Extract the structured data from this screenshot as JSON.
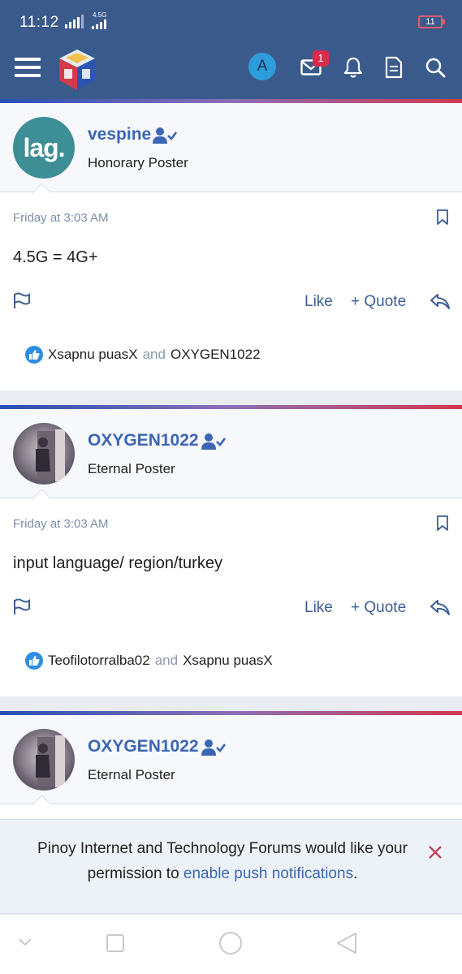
{
  "status_bar": {
    "time": "11:12",
    "network_label": "4.5G",
    "battery": "11"
  },
  "header": {
    "menu_icon": "hamburger-icon",
    "logo_icon": "forum-logo-cube",
    "account_initial": "A",
    "inbox_badge": "1",
    "icons": [
      "envelope-icon",
      "bell-icon",
      "document-icon",
      "search-icon"
    ]
  },
  "posts": [
    {
      "username": "vespine",
      "role": "Honorary Poster",
      "avatar_text": "lag.",
      "date": "Friday at 3:03 AM",
      "content": "4.5G = 4G+",
      "like_label": "Like",
      "quote_label": "+ Quote",
      "reactions": {
        "user1": "Xsapnu puasX",
        "joiner": "and",
        "user2": "OXYGEN1022"
      }
    },
    {
      "username": "OXYGEN1022",
      "role": "Eternal Poster",
      "date": "Friday at 3:03 AM",
      "content": "input language/ region/turkey",
      "like_label": "Like",
      "quote_label": "+ Quote",
      "reactions": {
        "user1": "Teofilotorralba02",
        "joiner": "and",
        "user2": "Xsapnu puasX"
      }
    },
    {
      "username": "OXYGEN1022",
      "role": "Eternal Poster"
    }
  ],
  "push_notice": {
    "text_before": "Pinoy Internet and Technology Forums would like your permission to ",
    "link_text": "enable push notifications",
    "text_after": "."
  },
  "colors": {
    "header_bg": "#3b5a8c",
    "username": "#3b66b5",
    "link": "#3b66b5",
    "like_blue": "#2d8fe0",
    "badge_red": "#d62b49",
    "stripe_left": "#2750b4",
    "stripe_right": "#d1394f"
  }
}
